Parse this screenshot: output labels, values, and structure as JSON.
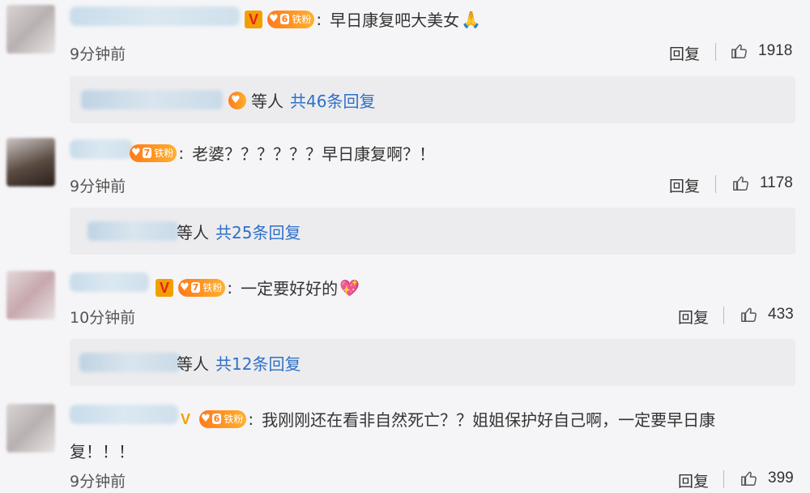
{
  "comments": [
    {
      "text": "早日康复吧大美女",
      "emoji": "🙏",
      "time": "9分钟前",
      "reply_label": "回复",
      "likes": "1918",
      "sub_suffix": "等人",
      "sub_more": "共46条回复"
    },
    {
      "text": "老婆？？？？？？早日康复啊？！",
      "time": "9分钟前",
      "reply_label": "回复",
      "likes": "1178",
      "sub_suffix": "等人",
      "sub_more": "共25条回复"
    },
    {
      "text": "一定要好好的",
      "emoji": "💖",
      "time": "10分钟前",
      "reply_label": "回复",
      "likes": "433",
      "sub_suffix": "等人",
      "sub_more": "共12条回复"
    },
    {
      "text": "我刚刚还在看非自然死亡？？姐姐保护好自己啊，一定要早日康",
      "text_line2": "复！！！",
      "time": "9分钟前",
      "reply_label": "回复",
      "likes": "399"
    }
  ],
  "badges": {
    "v_label": "V",
    "fan_label": "铁粉",
    "fan_level_6": "6",
    "fan_level_7": "7",
    "colon": ":"
  },
  "icons": {
    "like": "thumbs-up-icon",
    "verified": "verified-v-icon",
    "fan": "fan-badge-icon"
  },
  "colors": {
    "link": "#2e70c8",
    "badge_orange": "#ff7a1a",
    "v_badge": "#f2a000"
  }
}
